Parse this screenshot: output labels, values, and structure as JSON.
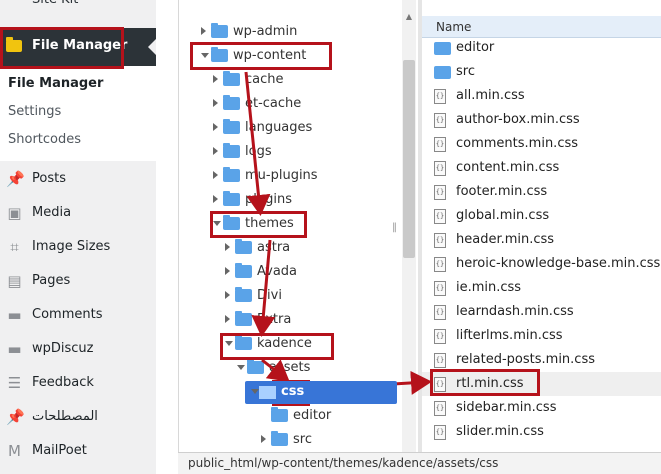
{
  "sidebar": {
    "top_item": "Site Kit",
    "active": {
      "label": "File Manager",
      "icon": "folder-icon"
    },
    "submenu": [
      "File Manager",
      "Settings",
      "Shortcodes"
    ],
    "menu": [
      {
        "label": "Posts",
        "icon": "pin-icon"
      },
      {
        "label": "Media",
        "icon": "media-icon"
      },
      {
        "label": "Image Sizes",
        "icon": "crop-icon"
      },
      {
        "label": "Pages",
        "icon": "pages-icon"
      },
      {
        "label": "Comments",
        "icon": "comment-icon"
      },
      {
        "label": "wpDiscuz",
        "icon": "comment-icon"
      },
      {
        "label": "Feedback",
        "icon": "feedback-icon"
      },
      {
        "label": "المصطلحات",
        "icon": "pin-icon"
      },
      {
        "label": "MailPoet",
        "icon": "mailpoet-icon"
      }
    ]
  },
  "tree": [
    {
      "label": "wp-admin",
      "state": "collapsed",
      "depth": 0
    },
    {
      "label": "wp-content",
      "state": "expanded",
      "depth": 0
    },
    {
      "label": "cache",
      "state": "collapsed",
      "depth": 1
    },
    {
      "label": "et-cache",
      "state": "collapsed",
      "depth": 1
    },
    {
      "label": "languages",
      "state": "collapsed",
      "depth": 1
    },
    {
      "label": "logs",
      "state": "collapsed",
      "depth": 1
    },
    {
      "label": "mu-plugins",
      "state": "collapsed",
      "depth": 1
    },
    {
      "label": "plugins",
      "state": "collapsed",
      "depth": 1
    },
    {
      "label": "themes",
      "state": "expanded",
      "depth": 1
    },
    {
      "label": "astra",
      "state": "collapsed",
      "depth": 2
    },
    {
      "label": "Avada",
      "state": "collapsed",
      "depth": 2
    },
    {
      "label": "Divi",
      "state": "collapsed",
      "depth": 2
    },
    {
      "label": "Extra",
      "state": "collapsed",
      "depth": 2
    },
    {
      "label": "kadence",
      "state": "expanded",
      "depth": 2
    },
    {
      "label": "assets",
      "state": "expanded",
      "depth": 3
    },
    {
      "label": "css",
      "state": "selected",
      "depth": 4
    },
    {
      "label": "editor",
      "state": "leaf",
      "depth": 5
    },
    {
      "label": "src",
      "state": "collapsed",
      "depth": 5
    }
  ],
  "files": {
    "header": "Name",
    "items": [
      {
        "name": "editor",
        "type": "folder"
      },
      {
        "name": "src",
        "type": "folder"
      },
      {
        "name": "all.min.css",
        "type": "file"
      },
      {
        "name": "author-box.min.css",
        "type": "file"
      },
      {
        "name": "comments.min.css",
        "type": "file"
      },
      {
        "name": "content.min.css",
        "type": "file"
      },
      {
        "name": "footer.min.css",
        "type": "file"
      },
      {
        "name": "global.min.css",
        "type": "file"
      },
      {
        "name": "header.min.css",
        "type": "file"
      },
      {
        "name": "heroic-knowledge-base.min.css",
        "type": "file"
      },
      {
        "name": "ie.min.css",
        "type": "file"
      },
      {
        "name": "learndash.min.css",
        "type": "file"
      },
      {
        "name": "lifterlms.min.css",
        "type": "file"
      },
      {
        "name": "related-posts.min.css",
        "type": "file"
      },
      {
        "name": "rtl.min.css",
        "type": "file",
        "highlighted": true
      },
      {
        "name": "sidebar.min.css",
        "type": "file"
      },
      {
        "name": "slider.min.css",
        "type": "file"
      }
    ]
  },
  "status_path": "public_html/wp-content/themes/kadence/assets/css",
  "colors": {
    "annotation": "#b5121b",
    "selection": "#3875d7",
    "folder": "#5aa3e8",
    "wp_dark": "#2c3338"
  }
}
